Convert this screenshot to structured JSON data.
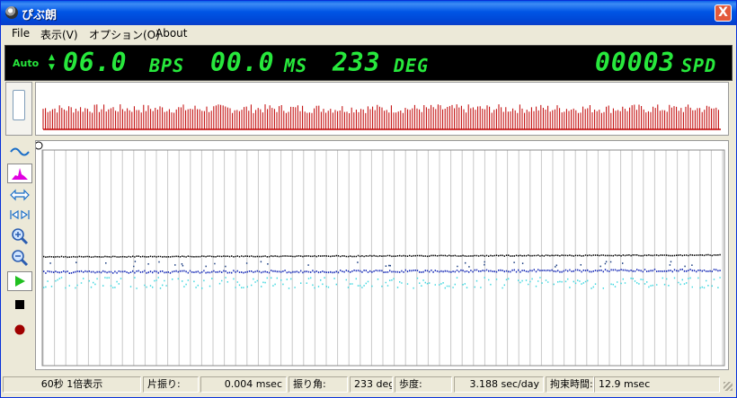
{
  "window": {
    "title": "ぴぶ朗",
    "close": "X"
  },
  "menu": [
    {
      "label": "File"
    },
    {
      "label": "表示(V)"
    },
    {
      "label": "オプション(O)"
    },
    {
      "label": "About"
    }
  ],
  "display": {
    "mode": "Auto",
    "bps_value": "06.0",
    "bps_unit": "BPS",
    "ms_value": "00.0",
    "ms_unit": "MS",
    "deg_value": "233",
    "deg_unit": "DEG",
    "spd_value": "00003",
    "spd_unit": "SPD",
    "color": "#27e83c"
  },
  "toolbar": {
    "icons": [
      "wave-icon",
      "histogram-icon",
      "expand-h-icon",
      "shrink-h-icon",
      "zoom-in-icon",
      "zoom-out-icon",
      "play-icon",
      "stop-icon",
      "record-icon"
    ]
  },
  "status": {
    "view": "60秒 1倍表示",
    "amp_label": "片振り:",
    "amp_value": "0.004 msec",
    "angle_label": "振り角:",
    "angle_value": "233 deg",
    "rate_label": "歩度:",
    "rate_value": "3.188 sec/day",
    "lock_label": "拘束時間:",
    "lock_value": "12.9 msec"
  },
  "colors": {
    "strip_spikes": "#c00000",
    "trace_black": "#000000",
    "trace_blue": "#1a2db8",
    "trace_cyan": "#40d8e0",
    "titlebar": "#0055e5"
  }
}
